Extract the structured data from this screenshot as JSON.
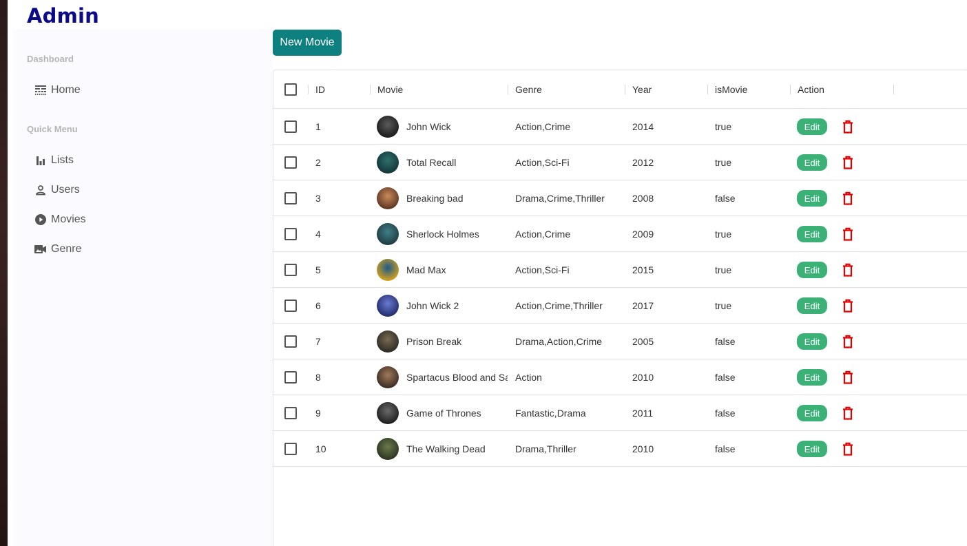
{
  "app": {
    "title": "Admin"
  },
  "sidebar": {
    "sections": [
      {
        "title": "Dashboard",
        "items": [
          {
            "label": "Home",
            "icon": "line-style-icon"
          }
        ]
      },
      {
        "title": "Quick Menu",
        "items": [
          {
            "label": "Lists",
            "icon": "bar-chart-icon"
          },
          {
            "label": "Users",
            "icon": "person-icon"
          },
          {
            "label": "Movies",
            "icon": "play-circle-icon"
          },
          {
            "label": "Genre",
            "icon": "video-camera-icon"
          }
        ]
      }
    ]
  },
  "toolbar": {
    "new_label": "New Movie"
  },
  "table": {
    "columns": [
      "ID",
      "Movie",
      "Genre",
      "Year",
      "isMovie",
      "Action"
    ],
    "edit_label": "Edit",
    "rows": [
      {
        "id": "1",
        "movie": "John Wick",
        "genre": "Action,Crime",
        "year": "2014",
        "isMovie": "true"
      },
      {
        "id": "2",
        "movie": "Total Recall",
        "genre": "Action,Sci-Fi",
        "year": "2012",
        "isMovie": "true"
      },
      {
        "id": "3",
        "movie": "Breaking bad",
        "genre": "Drama,Crime,Thriller",
        "year": "2008",
        "isMovie": "false"
      },
      {
        "id": "4",
        "movie": "Sherlock Holmes",
        "genre": "Action,Crime",
        "year": "2009",
        "isMovie": "true"
      },
      {
        "id": "5",
        "movie": "Mad Max",
        "genre": "Action,Sci-Fi",
        "year": "2015",
        "isMovie": "true"
      },
      {
        "id": "6",
        "movie": "John Wick 2",
        "genre": "Action,Crime,Thriller",
        "year": "2017",
        "isMovie": "true"
      },
      {
        "id": "7",
        "movie": "Prison Break",
        "genre": "Drama,Action,Crime",
        "year": "2005",
        "isMovie": "false"
      },
      {
        "id": "8",
        "movie": "Spartacus Blood and Sand",
        "genre": "Action",
        "year": "2010",
        "isMovie": "false"
      },
      {
        "id": "9",
        "movie": "Game of Thrones",
        "genre": "Fantastic,Drama",
        "year": "2011",
        "isMovie": "false"
      },
      {
        "id": "10",
        "movie": "The Walking Dead",
        "genre": "Drama,Thriller",
        "year": "2010",
        "isMovie": "false"
      }
    ]
  },
  "colors": {
    "brand": "#0b0b8a",
    "new_button": "#0e8080",
    "edit_button": "#3bb077",
    "delete_icon": "#e00000",
    "sidebar_bg": "#fbfbff"
  }
}
